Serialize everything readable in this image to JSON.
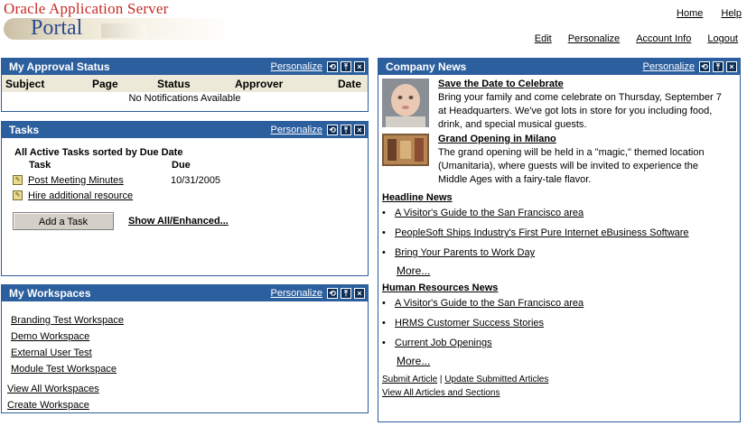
{
  "brand": {
    "line1": "Oracle Application Server",
    "line2": "Portal"
  },
  "top_links": [
    "Home",
    "Help"
  ],
  "global_links": [
    "Edit",
    "Personalize",
    "Account Info",
    "Logout"
  ],
  "approval": {
    "title": "My Approval Status",
    "personalize": "Personalize",
    "columns": [
      "Subject",
      "Page",
      "Status",
      "Approver",
      "Date"
    ],
    "empty": "No Notifications Available"
  },
  "tasks": {
    "title": "Tasks",
    "personalize": "Personalize",
    "heading": "All Active Tasks sorted by Due Date",
    "col_task": "Task",
    "col_due": "Due",
    "rows": [
      {
        "name": "Post Meeting Minutes",
        "due": "10/31/2005"
      },
      {
        "name": "Hire additional resource",
        "due": ""
      }
    ],
    "add_button": "Add a Task",
    "show_all": "Show All/Enhanced..."
  },
  "workspaces": {
    "title": "My Workspaces",
    "personalize": "Personalize",
    "items": [
      "Branding Test Workspace",
      "Demo Workspace",
      "External User Test",
      "Module Test Workspace"
    ],
    "view_all": "View All Workspaces",
    "create": "Create Workspace"
  },
  "news": {
    "title": "Company News",
    "personalize": "Personalize",
    "featured": [
      {
        "title": "Save the Date to Celebrate",
        "text": "Bring your family and come celebrate on Thursday, September 7 at Headquarters. We've got lots in store for you including food, drink, and special musical guests."
      },
      {
        "title": "Grand Opening in Milano",
        "text": "The grand opening will be held in a \"magic,\" themed location (Umanitaria), where guests will be invited to experience the Middle Ages with a fairy-tale flavor."
      }
    ],
    "headline": {
      "title": "Headline News",
      "items": [
        "A Visitor's Guide to the San Francisco area",
        "PeopleSoft Ships Industry's First Pure Internet eBusiness Software",
        "Bring Your Parents to Work Day"
      ],
      "more": "More..."
    },
    "hr": {
      "title": "Human Resources News",
      "items": [
        "A Visitor's Guide to the San Francisco area",
        "HRMS Customer Success Stories",
        "Current Job Openings"
      ],
      "more": "More..."
    },
    "submit": "Submit Article",
    "update": "Update Submitted Articles",
    "view_all": "View All Articles and Sections"
  },
  "colors": {
    "header_blue": "#2c5f9e",
    "brand_red": "#c62b25",
    "portal_blue": "#2d4a8c"
  }
}
